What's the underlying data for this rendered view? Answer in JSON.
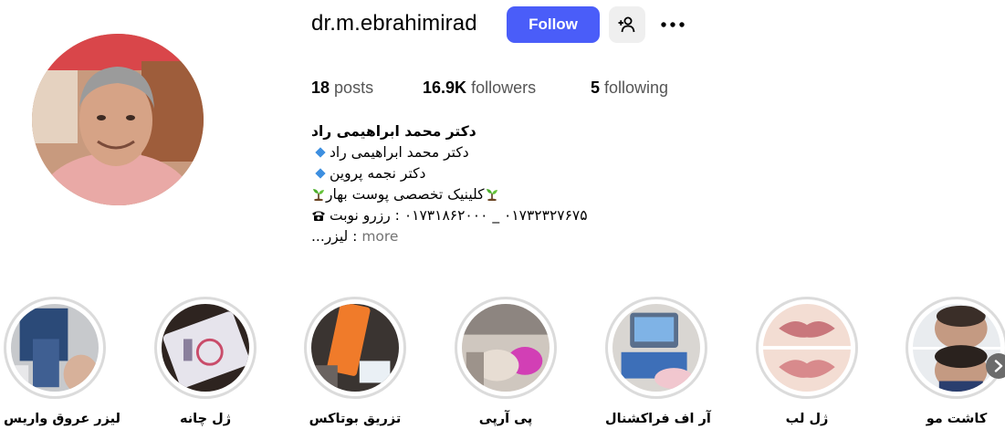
{
  "profile": {
    "username": "dr.m.ebrahimirad",
    "follow_label": "Follow",
    "stats": {
      "posts_count": "18",
      "posts_label": "posts",
      "followers_count": "16.9K",
      "followers_label": "followers",
      "following_count": "5",
      "following_label": "following"
    },
    "bio": {
      "name": "دکتر محمد ابراهیمی راد",
      "line1": "دکتر محمد ابراهیمی راد",
      "line2": "دکتر نجمه پروین",
      "line3": "کلینیک تخصصی پوست بهار",
      "line4": "۰۱۷۳۲۳۲۷۶۷۵ _ ۰۱۷۳۱۸۶۲۰۰۰ : رزرو نوبت",
      "line5": ": لیزر...",
      "more_label": "more"
    }
  },
  "highlights": [
    {
      "label": "لیزر عروق واریس"
    },
    {
      "label": "ژل چانه"
    },
    {
      "label": "تزریق بوتاکس"
    },
    {
      "label": "پی آرپی"
    },
    {
      "label": "آر اف فراکشنال"
    },
    {
      "label": "ژل لب"
    },
    {
      "label": "کاشت مو"
    }
  ],
  "icons": {
    "suggest": "add-person-icon",
    "more": "more-horizontal-icon",
    "next": "chevron-right-icon"
  },
  "colors": {
    "follow_button": "#4a5df9",
    "secondary_button": "#efefef",
    "ring": "#dbdbdb",
    "muted_text": "#737373"
  }
}
